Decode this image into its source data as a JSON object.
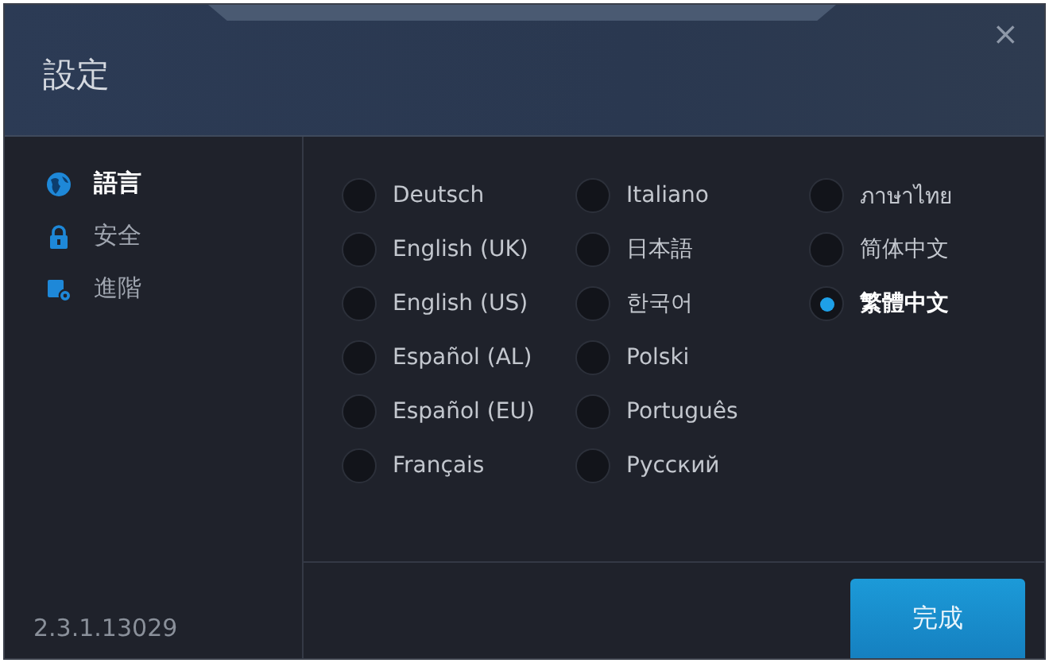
{
  "window": {
    "title": "設定",
    "close": "×"
  },
  "sidebar": {
    "items": [
      {
        "label": "語言",
        "selected": true
      },
      {
        "label": "安全",
        "selected": false
      },
      {
        "label": "進階",
        "selected": false
      }
    ],
    "version": "2.3.1.13029"
  },
  "languages": [
    {
      "label": "Deutsch",
      "selected": false
    },
    {
      "label": "English (UK)",
      "selected": false
    },
    {
      "label": "English (US)",
      "selected": false
    },
    {
      "label": "Español (AL)",
      "selected": false
    },
    {
      "label": "Español (EU)",
      "selected": false
    },
    {
      "label": "Français",
      "selected": false
    },
    {
      "label": "Italiano",
      "selected": false
    },
    {
      "label": "日本語",
      "selected": false
    },
    {
      "label": "한국어",
      "selected": false
    },
    {
      "label": "Polski",
      "selected": false
    },
    {
      "label": "Português",
      "selected": false
    },
    {
      "label": "Русский",
      "selected": false
    },
    {
      "label": "ภาษาไทย",
      "selected": false
    },
    {
      "label": "简体中文",
      "selected": false
    },
    {
      "label": "繁體中文",
      "selected": true
    }
  ],
  "buttons": {
    "done": "完成"
  }
}
